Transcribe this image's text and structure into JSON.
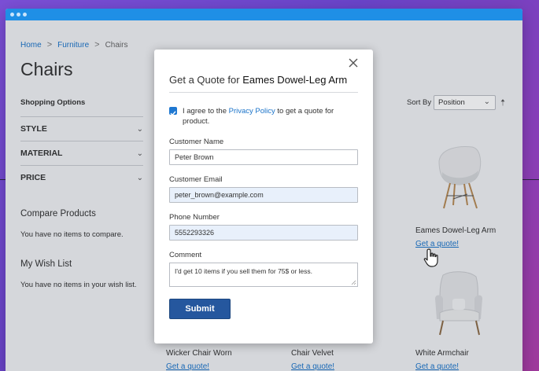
{
  "breadcrumb": {
    "home": "Home",
    "sep": ">",
    "category": "Furniture",
    "current": "Chairs"
  },
  "page": {
    "title": "Chairs"
  },
  "sidebar": {
    "shopping_options": "Shopping Options",
    "filters": [
      {
        "label": "STYLE"
      },
      {
        "label": "MATERIAL"
      },
      {
        "label": "PRICE"
      }
    ],
    "compare_title": "Compare Products",
    "compare_text": "You have no items to compare.",
    "wishlist_title": "My Wish List",
    "wishlist_text": "You have no items in your wish list."
  },
  "toolbar": {
    "sort_by_label": "Sort By",
    "sort_value": "Position"
  },
  "products": [
    {
      "name": "Eames Dowel-Leg Arm",
      "link": "Get a quote!"
    },
    {
      "name": "Wicker Chair Worn",
      "link": "Get a quote!"
    },
    {
      "name": "Chair Velvet",
      "link": "Get a quote!"
    },
    {
      "name": "White Armchair",
      "link": "Get a quote!"
    }
  ],
  "modal": {
    "title_prefix": "Get a Quote for",
    "title_product": "Eames Dowel-Leg Arm",
    "agree_before": "I agree to the ",
    "agree_link": "Privacy Policy",
    "agree_after": " to get a quote for product.",
    "fields": {
      "name_label": "Customer Name",
      "name_value": "Peter Brown",
      "email_label": "Customer Email",
      "email_value": "peter_brown@example.com",
      "phone_label": "Phone Number",
      "phone_value": "5552293326",
      "comment_label": "Comment",
      "comment_value": "I'd get 10 items if you sell them for 75$ or less."
    },
    "submit_label": "Submit"
  },
  "colors": {
    "accent": "#1f8fe6",
    "link": "#1a73c9",
    "submit": "#25579e"
  }
}
